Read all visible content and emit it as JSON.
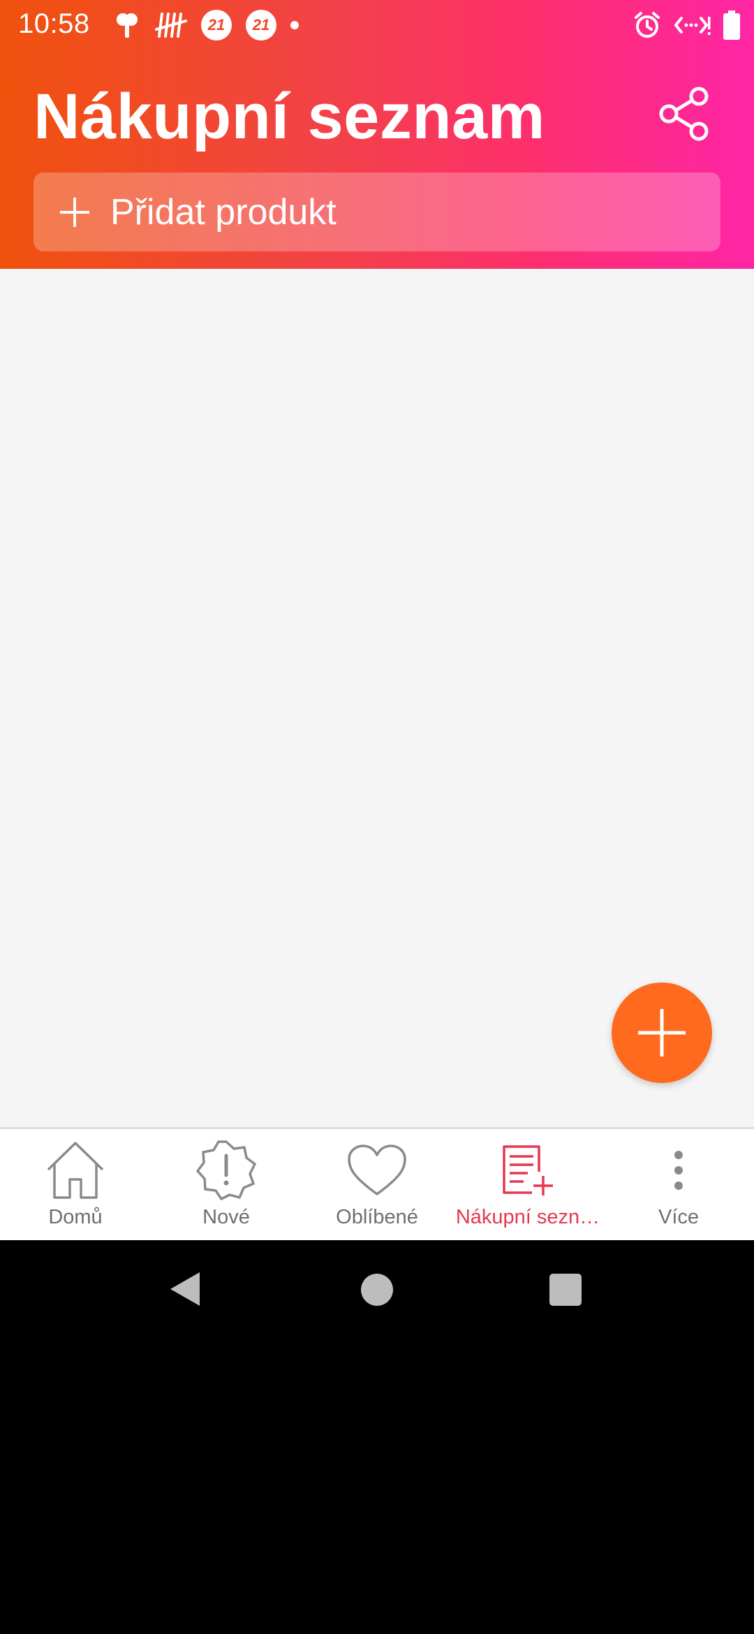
{
  "status_bar": {
    "time": "10:58",
    "left_icons": [
      "notification-icon",
      "tally-icon",
      "badge-21",
      "badge-21",
      "dot"
    ],
    "badge_text": "21",
    "right_icons": [
      "alarm-icon",
      "data-icon",
      "battery-icon"
    ]
  },
  "header": {
    "title": "Nákupní seznam",
    "add_product_label": "Přidat produkt",
    "gradient_start": "#f0520c",
    "gradient_end": "#ff25a6"
  },
  "fab": {
    "icon": "plus-icon",
    "color": "#ff6a1e"
  },
  "bottom_nav": {
    "items": [
      {
        "label": "Domů",
        "icon": "home-icon"
      },
      {
        "label": "Nové",
        "icon": "new-badge-icon"
      },
      {
        "label": "Oblíbené",
        "icon": "heart-icon"
      },
      {
        "label": "Nákupní sezn…",
        "icon": "shopping-list-icon",
        "active": true
      },
      {
        "label": "Více",
        "icon": "more-vertical-icon"
      }
    ],
    "active_color": "#e6374f"
  }
}
